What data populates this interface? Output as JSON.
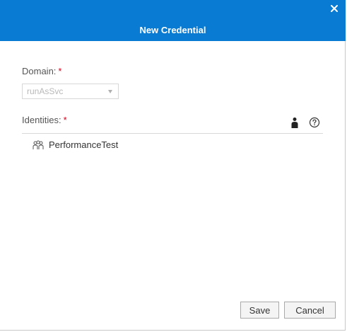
{
  "dialog": {
    "title": "New Credential",
    "close_icon": "close-icon"
  },
  "domain": {
    "label": "Domain:",
    "required_marker": "*",
    "selected_value": "runAsSvc"
  },
  "identities": {
    "label": "Identities:",
    "required_marker": "*",
    "toolbar": {
      "user_icon": "user-icon",
      "help_icon": "help-icon"
    },
    "items": [
      {
        "label": "PerformanceTest",
        "icon": "group-icon"
      }
    ]
  },
  "footer": {
    "save_label": "Save",
    "cancel_label": "Cancel"
  },
  "colors": {
    "title_bar": "#0a7bd3",
    "required": "#d0021b"
  }
}
